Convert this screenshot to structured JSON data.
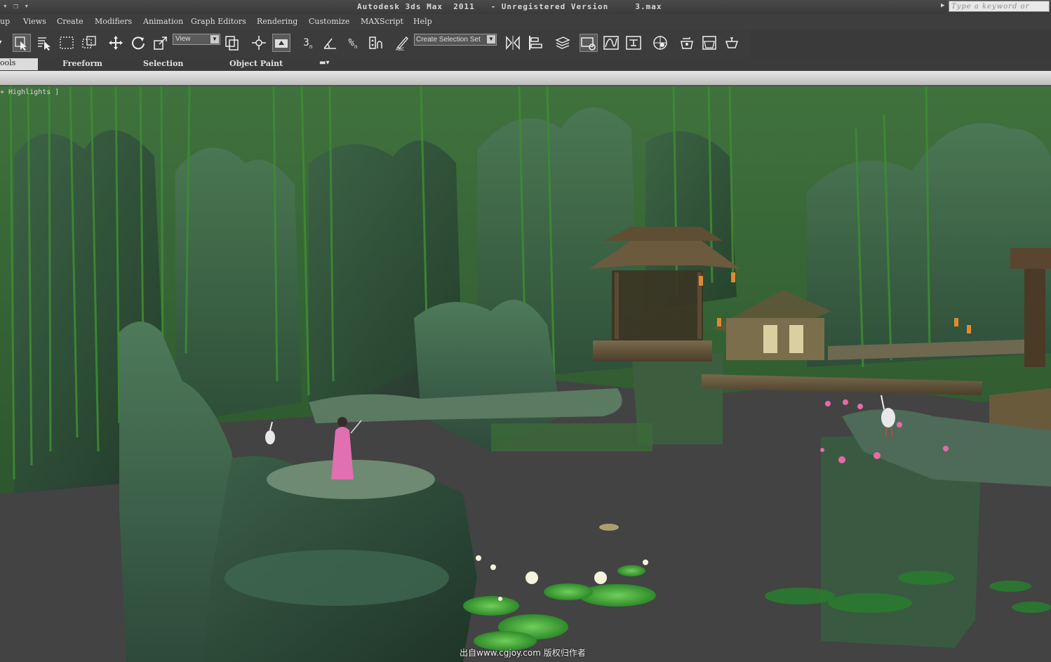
{
  "title_bar": {
    "quick_access": "▾ ❐ ▾",
    "title": "Autodesk 3ds Max  2011   - Unregistered Version     3.max",
    "search_placeholder": "Type a keyword or phrase"
  },
  "menu": {
    "items": [
      "up",
      "Views",
      "Create",
      "Modifiers",
      "Animation",
      "Graph Editors",
      "Rendering",
      "Customize",
      "MAXScript",
      "Help"
    ]
  },
  "toolbar": {
    "reference_coord": "View",
    "named_selection": "Create Selection Set",
    "icons": [
      "select-object-icon",
      "select-by-name-icon",
      "rect-selection-icon",
      "window-crossing-icon",
      "move-icon",
      "rotate-icon",
      "scale-icon",
      "use-pivot-icon",
      "select-manipulate-icon",
      "keyboard-shortcut-icon",
      "snap-3d-icon",
      "angle-snap-icon",
      "percent-snap-icon",
      "spinner-snap-icon",
      "edit-named-sets-icon",
      "mirror-icon",
      "align-icon",
      "layer-manager-icon",
      "graphite-toggle-icon",
      "curve-editor-icon",
      "schematic-view-icon",
      "material-editor-icon",
      "render-setup-icon",
      "render-frame-icon",
      "render-production-icon"
    ]
  },
  "ribbon": {
    "tabs": [
      "ools",
      "Freeform",
      "Selection",
      "Object Paint"
    ],
    "selected_tab": "ools"
  },
  "viewport": {
    "label": "+ Highlights ]",
    "watermark": "出自www.cgjoy.com 版权归作者",
    "background_color": "#434343"
  }
}
